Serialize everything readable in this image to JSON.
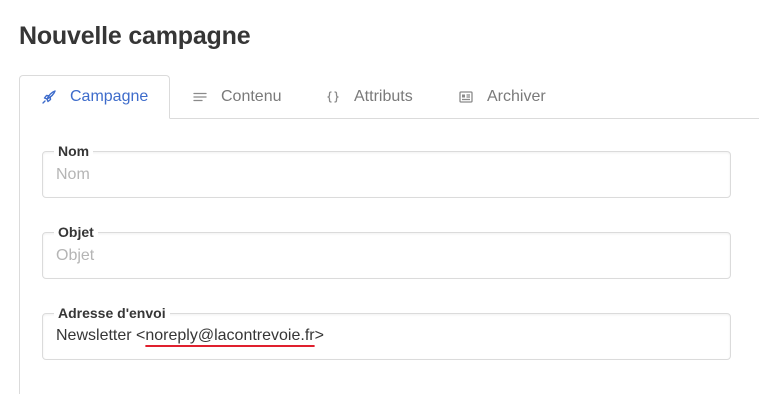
{
  "page": {
    "title": "Nouvelle campagne"
  },
  "tabs": [
    {
      "label": "Campagne",
      "icon": "rocket-icon",
      "active": true
    },
    {
      "label": "Contenu",
      "icon": "lines-icon",
      "active": false
    },
    {
      "label": "Attributs",
      "icon": "braces-icon",
      "active": false
    },
    {
      "label": "Archiver",
      "icon": "newspaper-icon",
      "active": false
    }
  ],
  "form": {
    "name": {
      "label": "Nom",
      "placeholder": "Nom",
      "value": ""
    },
    "subject": {
      "label": "Objet",
      "placeholder": "Objet",
      "value": ""
    },
    "sender": {
      "label": "Adresse d'envoi",
      "prefix": "Newsletter <",
      "email": "noreply@lacontrevoie.fr",
      "suffix": ">"
    }
  },
  "colors": {
    "accent": "#3e6ccb",
    "spellcheck_underline": "#e0202e",
    "border": "#dbdbdb"
  }
}
